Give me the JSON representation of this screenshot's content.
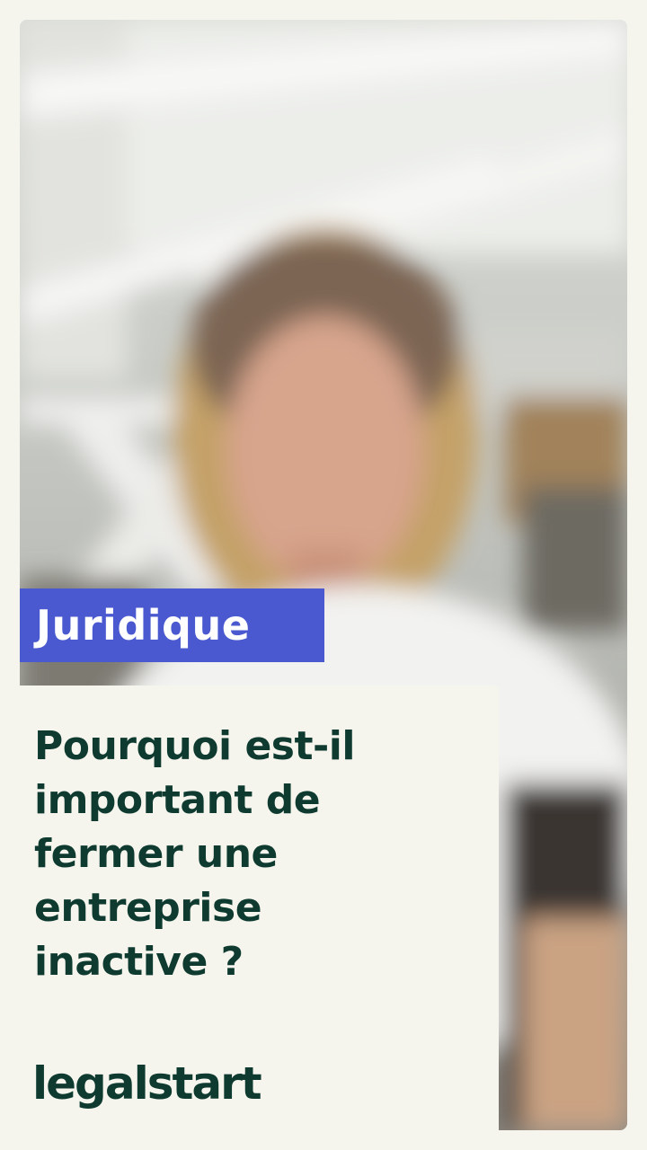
{
  "category_tag": "Juridique",
  "headline": "Pourquoi est-il\nimportant de\nfermer une\nentreprise\ninactive ?",
  "brand": "legalstart",
  "colors": {
    "page_background": "#f5f5ee",
    "tag_background": "#4a59cf",
    "tag_text": "#ffffff",
    "headline_text": "#0e3a2f",
    "brand_text": "#0e3a2f"
  }
}
